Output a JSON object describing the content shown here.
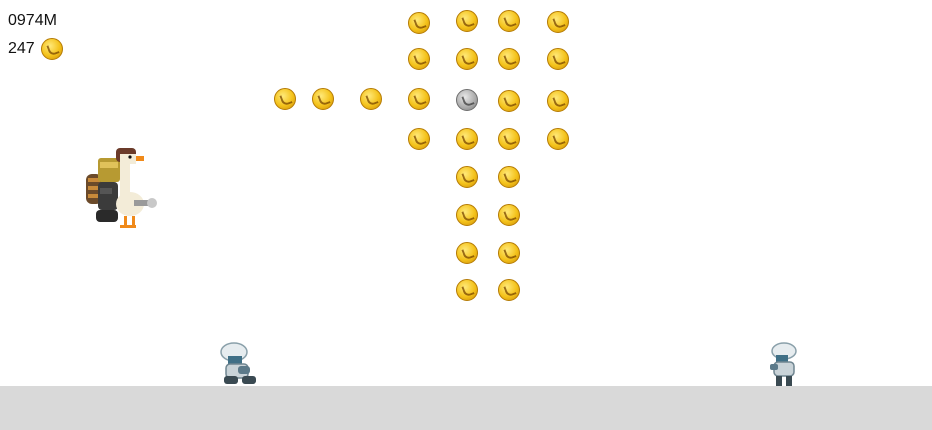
{
  "hud": {
    "distance": "0974M",
    "coin_count": "247",
    "coin_icon": "gold-coin-icon"
  },
  "colors": {
    "ground": "#d9d9d9",
    "coin_gold": "#f4c21a",
    "coin_silver": "#a9a9a9",
    "background": "#ffffff"
  },
  "scene": {
    "player": "goose-with-jetpack",
    "enemies": [
      "soldier-crouching",
      "soldier-standing"
    ],
    "coin_kinds": [
      "gold",
      "silver"
    ]
  }
}
